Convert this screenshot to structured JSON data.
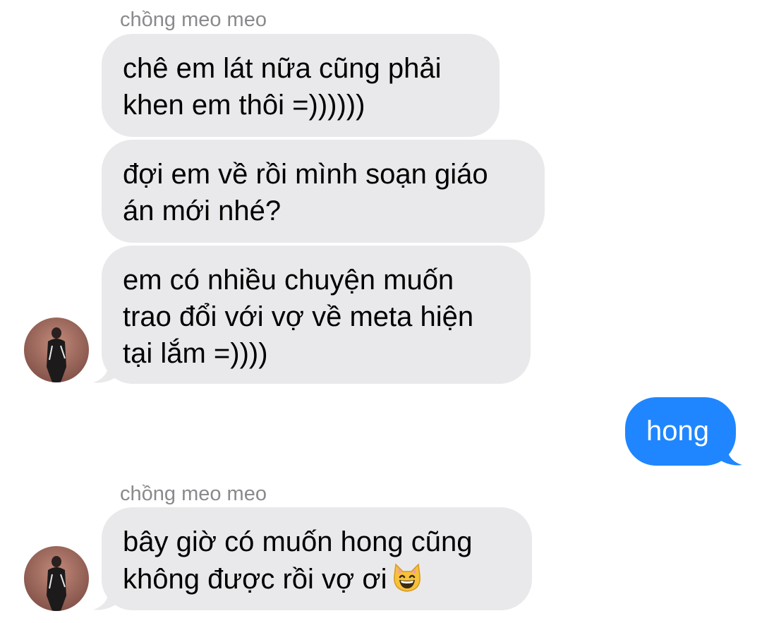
{
  "thread": {
    "messages": [
      {
        "sender": "chồng meo meo"
      },
      {
        "lines": [
          "chê em lát nữa cũng phải",
          "khen em thôi =))))))"
        ]
      },
      {
        "lines": [
          "đợi em về rồi mình soạn giáo",
          "án mới nhé?"
        ]
      },
      {
        "lines": [
          "em có nhiều chuyện muốn",
          "trao đổi với vợ về meta hiện",
          "tại lắm =))))"
        ]
      },
      {
        "text": "hong"
      },
      {
        "sender": "chồng meo meo"
      },
      {
        "lines": [
          "bây giờ có muốn hong cũng",
          "không được rồi vợ ơi"
        ]
      }
    ]
  },
  "colors": {
    "incoming_bubble": "#e9e9eb",
    "outgoing_bubble": "#1f86ff",
    "sender_label": "#8a8a8e"
  },
  "icons": {
    "avatar": "contact-avatar",
    "emoji": "grinning-cat-emoji"
  }
}
